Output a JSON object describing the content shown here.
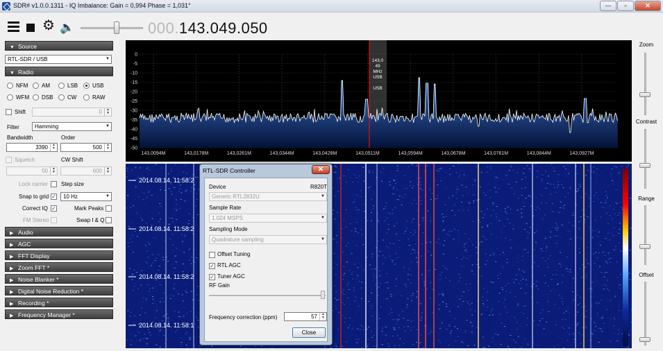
{
  "window": {
    "title": "SDR# v1.0.0.1311 - IQ Imbalance: Gain = 0,994 Phase = 1,031°",
    "minimize": "—",
    "maximize": "▫",
    "close": "✕"
  },
  "toolbar": {
    "frequency_dim": "000.",
    "frequency_main": "143.049.050",
    "volume_level": 0.55
  },
  "source": {
    "header": "Source",
    "device": "RTL-SDR / USB"
  },
  "radio": {
    "header": "Radio",
    "modes": [
      {
        "label": "NFM",
        "selected": false
      },
      {
        "label": "AM",
        "selected": false
      },
      {
        "label": "LSB",
        "selected": false
      },
      {
        "label": "USB",
        "selected": true
      },
      {
        "label": "WFM",
        "selected": false
      },
      {
        "label": "DSB",
        "selected": false
      },
      {
        "label": "CW",
        "selected": false
      },
      {
        "label": "RAW",
        "selected": false
      }
    ],
    "shift_label": "Shift",
    "shift_value": "0",
    "filter_label": "Filter",
    "filter_value": "Hamming",
    "bandwidth_label": "Bandwidth",
    "bandwidth_value": "3390",
    "order_label": "Order",
    "order_value": "500",
    "squelch_label": "Squelch",
    "squelch_value": "50",
    "cw_shift_label": "CW Shift",
    "cw_shift_value": "600",
    "lock_carrier_label": "Lock carrier",
    "step_size_label": "Step size",
    "snap_to_grid_label": "Snap to grid",
    "step_size_value": "10 Hz",
    "correct_iq_label": "Correct IQ",
    "mark_peaks_label": "Mark Peaks",
    "fm_stereo_label": "FM Stereo",
    "swap_iq_label": "Swap I & Q"
  },
  "sections": [
    "Audio",
    "AGC",
    "FFT Display",
    "Zoom FFT *",
    "Noise Blanker *",
    "Digital Noise Reduction *",
    "Recording *",
    "Frequency Manager *"
  ],
  "spectrum": {
    "y_ticks": [
      "0",
      "-5",
      "-10",
      "-15",
      "-20",
      "-25",
      "-30",
      "-35",
      "-40",
      "-45",
      "-50"
    ],
    "x_ticks": [
      "143,0094M",
      "143,0178M",
      "143,0261M",
      "143,0344M",
      "143,0428M",
      "143,0511M",
      "143,0594M",
      "143,0678M",
      "143,0761M",
      "143,0844M",
      "143,0927M"
    ],
    "marker_lines": [
      "143,0",
      "49",
      "MHz",
      "USB",
      "",
      "USB"
    ]
  },
  "waterfall": {
    "timestamps": [
      "2014.08.14. 11:58:2",
      "2014.08.14. 11:58:2",
      "2014.08.14. 11:58:2",
      "2014.08.14. 11:58:1"
    ]
  },
  "right_sliders": {
    "zoom": "Zoom",
    "contrast": "Contrast",
    "range": "Range",
    "offset": "Offset"
  },
  "dialog": {
    "title": "RTL-SDR Controller",
    "device_label": "Device",
    "tuner_type": "R820T",
    "device_value": "Generic RTL2832U",
    "sample_rate_label": "Sample Rate",
    "sample_rate_value": "1.024 MSPS",
    "sampling_mode_label": "Sampling Mode",
    "sampling_mode_value": "Quadrature sampling",
    "offset_tuning_label": "Offset Tuning",
    "rtl_agc_label": "RTL AGC",
    "tuner_agc_label": "Tuner AGC",
    "rf_gain_label": "RF Gain",
    "freq_correction_label": "Frequency correction (ppm)",
    "freq_correction_value": "57",
    "close_label": "Close"
  }
}
